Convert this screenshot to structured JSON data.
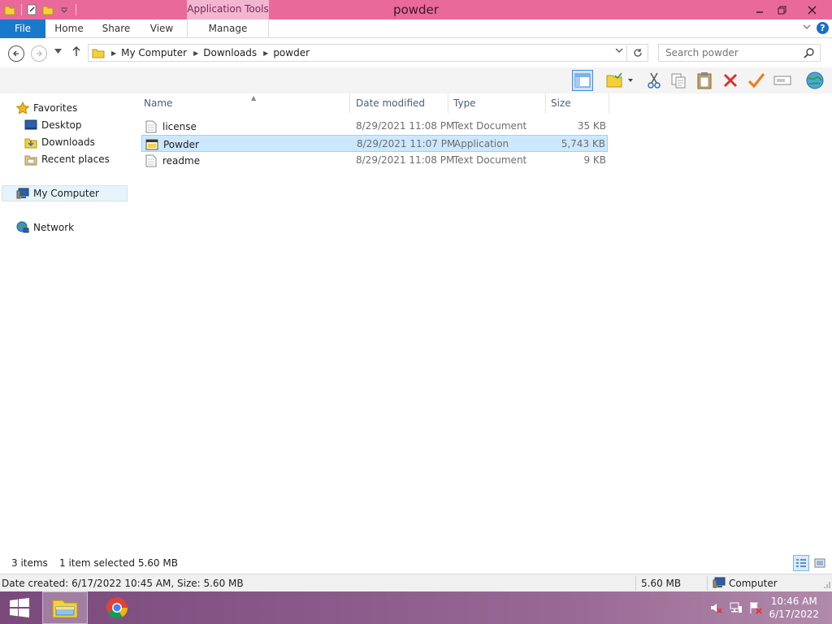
{
  "window": {
    "title": "powder",
    "context_tab_group": "Application Tools",
    "title_bar_color": "#e9699b"
  },
  "ribbon": {
    "tabs": [
      {
        "label": "File"
      },
      {
        "label": "Home"
      },
      {
        "label": "Share"
      },
      {
        "label": "View"
      },
      {
        "label": "Manage"
      }
    ]
  },
  "address": {
    "crumbs": [
      "My Computer",
      "Downloads",
      "powder"
    ],
    "search_placeholder": "Search powder"
  },
  "navigation": {
    "favorites_label": "Favorites",
    "favorites": [
      {
        "label": "Desktop",
        "icon": "desktop-icon"
      },
      {
        "label": "Downloads",
        "icon": "downloads-folder-icon"
      },
      {
        "label": "Recent places",
        "icon": "recent-places-icon"
      }
    ],
    "computer_label": "My Computer",
    "network_label": "Network"
  },
  "file_list": {
    "columns": {
      "name": "Name",
      "date": "Date modified",
      "type": "Type",
      "size": "Size"
    },
    "rows": [
      {
        "name": "license",
        "date": "8/29/2021 11:08 PM",
        "type": "Text Document",
        "size": "35 KB",
        "icon": "text-document-icon",
        "selected": false
      },
      {
        "name": "Powder",
        "date": "8/29/2021 11:07 PM",
        "type": "Application",
        "size": "5,743 KB",
        "icon": "application-icon",
        "selected": true
      },
      {
        "name": "readme",
        "date": "8/29/2021 11:08 PM",
        "type": "Text Document",
        "size": "9 KB",
        "icon": "text-document-icon",
        "selected": false
      }
    ]
  },
  "status": {
    "item_count": "3 items",
    "selection": "1 item selected  5.60 MB"
  },
  "details": {
    "info": "Date created: 6/17/2022 10:45 AM, Size: 5.60 MB",
    "size": "5.60 MB",
    "location": "Computer"
  },
  "taskbar": {
    "time": "10:46 AM",
    "date": "6/17/2022",
    "accent": "#7a4a7c"
  }
}
